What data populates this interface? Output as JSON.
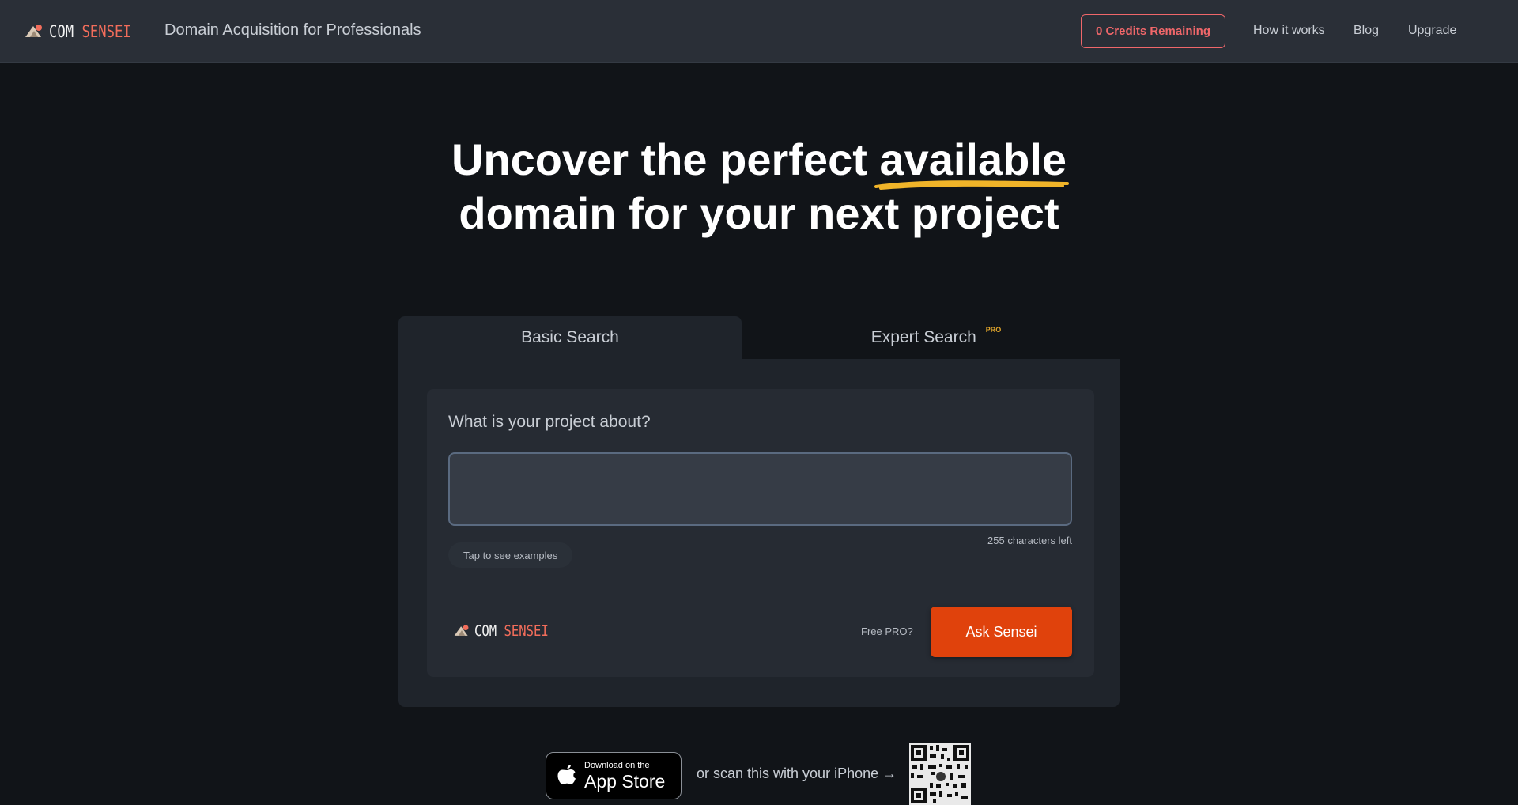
{
  "header": {
    "logo_word1": "COM",
    "logo_word2": "SENSEI",
    "tagline": "Domain Acquisition for Professionals",
    "credits_label": "0 Credits Remaining",
    "nav": [
      "How it works",
      "Blog",
      "Upgrade"
    ]
  },
  "hero": {
    "line1_before": "Uncover the perfect ",
    "line1_highlight": "available",
    "line2": "domain for your next project"
  },
  "tabs": {
    "basic": "Basic Search",
    "expert": "Expert Search",
    "expert_badge": "PRO"
  },
  "form": {
    "question": "What is your project about?",
    "input_value": "",
    "chars_left": "255 characters left",
    "examples_label": "Tap to see examples",
    "free_pro": "Free PRO?",
    "submit_label": "Ask Sensei"
  },
  "footer": {
    "appstore_small": "Download on the",
    "appstore_big": "App Store",
    "scan_text": "or scan this with your iPhone →"
  },
  "colors": {
    "accent": "#e0420c",
    "credits": "#f0676a",
    "underline": "#f0b429",
    "logo_accent": "#f26d5b"
  },
  "icons": [
    "logo-icon",
    "apple-icon",
    "qr-code"
  ]
}
